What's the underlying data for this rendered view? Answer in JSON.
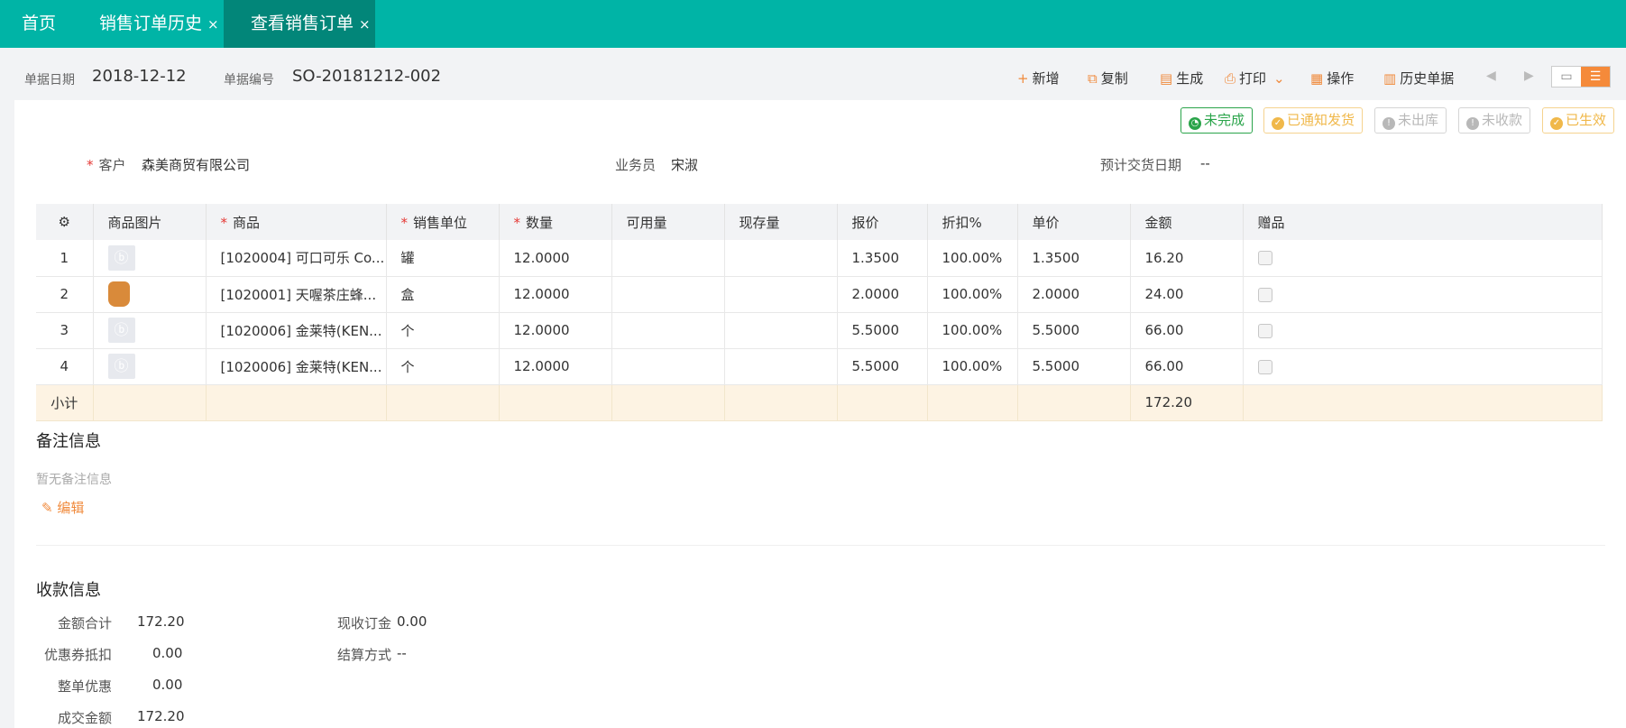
{
  "tabs": [
    {
      "label": "首页",
      "closable": false
    },
    {
      "label": "销售订单历史",
      "closable": true
    },
    {
      "label": "查看销售订单",
      "closable": true,
      "active": true
    }
  ],
  "close_glyph": "×",
  "header": {
    "date_label": "单据日期",
    "date_value": "2018-12-12",
    "no_label": "单据编号",
    "no_value": "SO-20181212-002"
  },
  "actions": {
    "new": "新增",
    "copy": "复制",
    "generate": "生成",
    "print": "打印",
    "operate": "操作",
    "history": "历史单据"
  },
  "status_badges": [
    {
      "label": "未完成",
      "color": "#2aa44a"
    },
    {
      "label": "已通知发货",
      "color": "#f0b84a"
    },
    {
      "label": "未出库",
      "color": "#b8b8b8"
    },
    {
      "label": "未收款",
      "color": "#b8b8b8"
    },
    {
      "label": "已生效",
      "color": "#f0b84a"
    }
  ],
  "form": {
    "customer_label": "客户",
    "customer_value": "森美商贸有限公司",
    "salesman_label": "业务员",
    "salesman_value": "宋淑",
    "delivery_label": "预计交货日期",
    "delivery_value": "--"
  },
  "table": {
    "columns": [
      "商品图片",
      "商品",
      "销售单位",
      "数量",
      "可用量",
      "现存量",
      "报价",
      "折扣%",
      "单价",
      "金额",
      "赠品"
    ],
    "rows": [
      {
        "no": "1",
        "product": "[1020004] 可口可乐 Co...",
        "unit": "罐",
        "qty": "12.0000",
        "avail": "",
        "stock": "",
        "quote": "1.3500",
        "discount": "100.00%",
        "price": "1.3500",
        "amount": "16.20"
      },
      {
        "no": "2",
        "product": "[1020001] 天喔茶庄蜂...",
        "unit": "盒",
        "qty": "12.0000",
        "avail": "",
        "stock": "",
        "quote": "2.0000",
        "discount": "100.00%",
        "price": "2.0000",
        "amount": "24.00"
      },
      {
        "no": "3",
        "product": "[1020006] 金莱特(KEN...",
        "unit": "个",
        "qty": "12.0000",
        "avail": "",
        "stock": "",
        "quote": "5.5000",
        "discount": "100.00%",
        "price": "5.5000",
        "amount": "66.00"
      },
      {
        "no": "4",
        "product": "[1020006] 金莱特(KEN...",
        "unit": "个",
        "qty": "12.0000",
        "avail": "",
        "stock": "",
        "quote": "5.5000",
        "discount": "100.00%",
        "price": "5.5000",
        "amount": "66.00"
      }
    ],
    "subtotal_label": "小计",
    "subtotal_amount": "172.20"
  },
  "remarks": {
    "title": "备注信息",
    "empty": "暂无备注信息",
    "edit": "编辑"
  },
  "payment": {
    "title": "收款信息",
    "total_label": "金额合计",
    "total_value": "172.20",
    "coupon_label": "优惠券抵扣",
    "coupon_value": "0.00",
    "discount_label": "整单优惠",
    "discount_value": "0.00",
    "deal_label": "成交金额",
    "deal_value": "172.20",
    "deposit_label": "现收订金",
    "deposit_value": "0.00",
    "settle_label": "结算方式",
    "settle_value": "--"
  }
}
